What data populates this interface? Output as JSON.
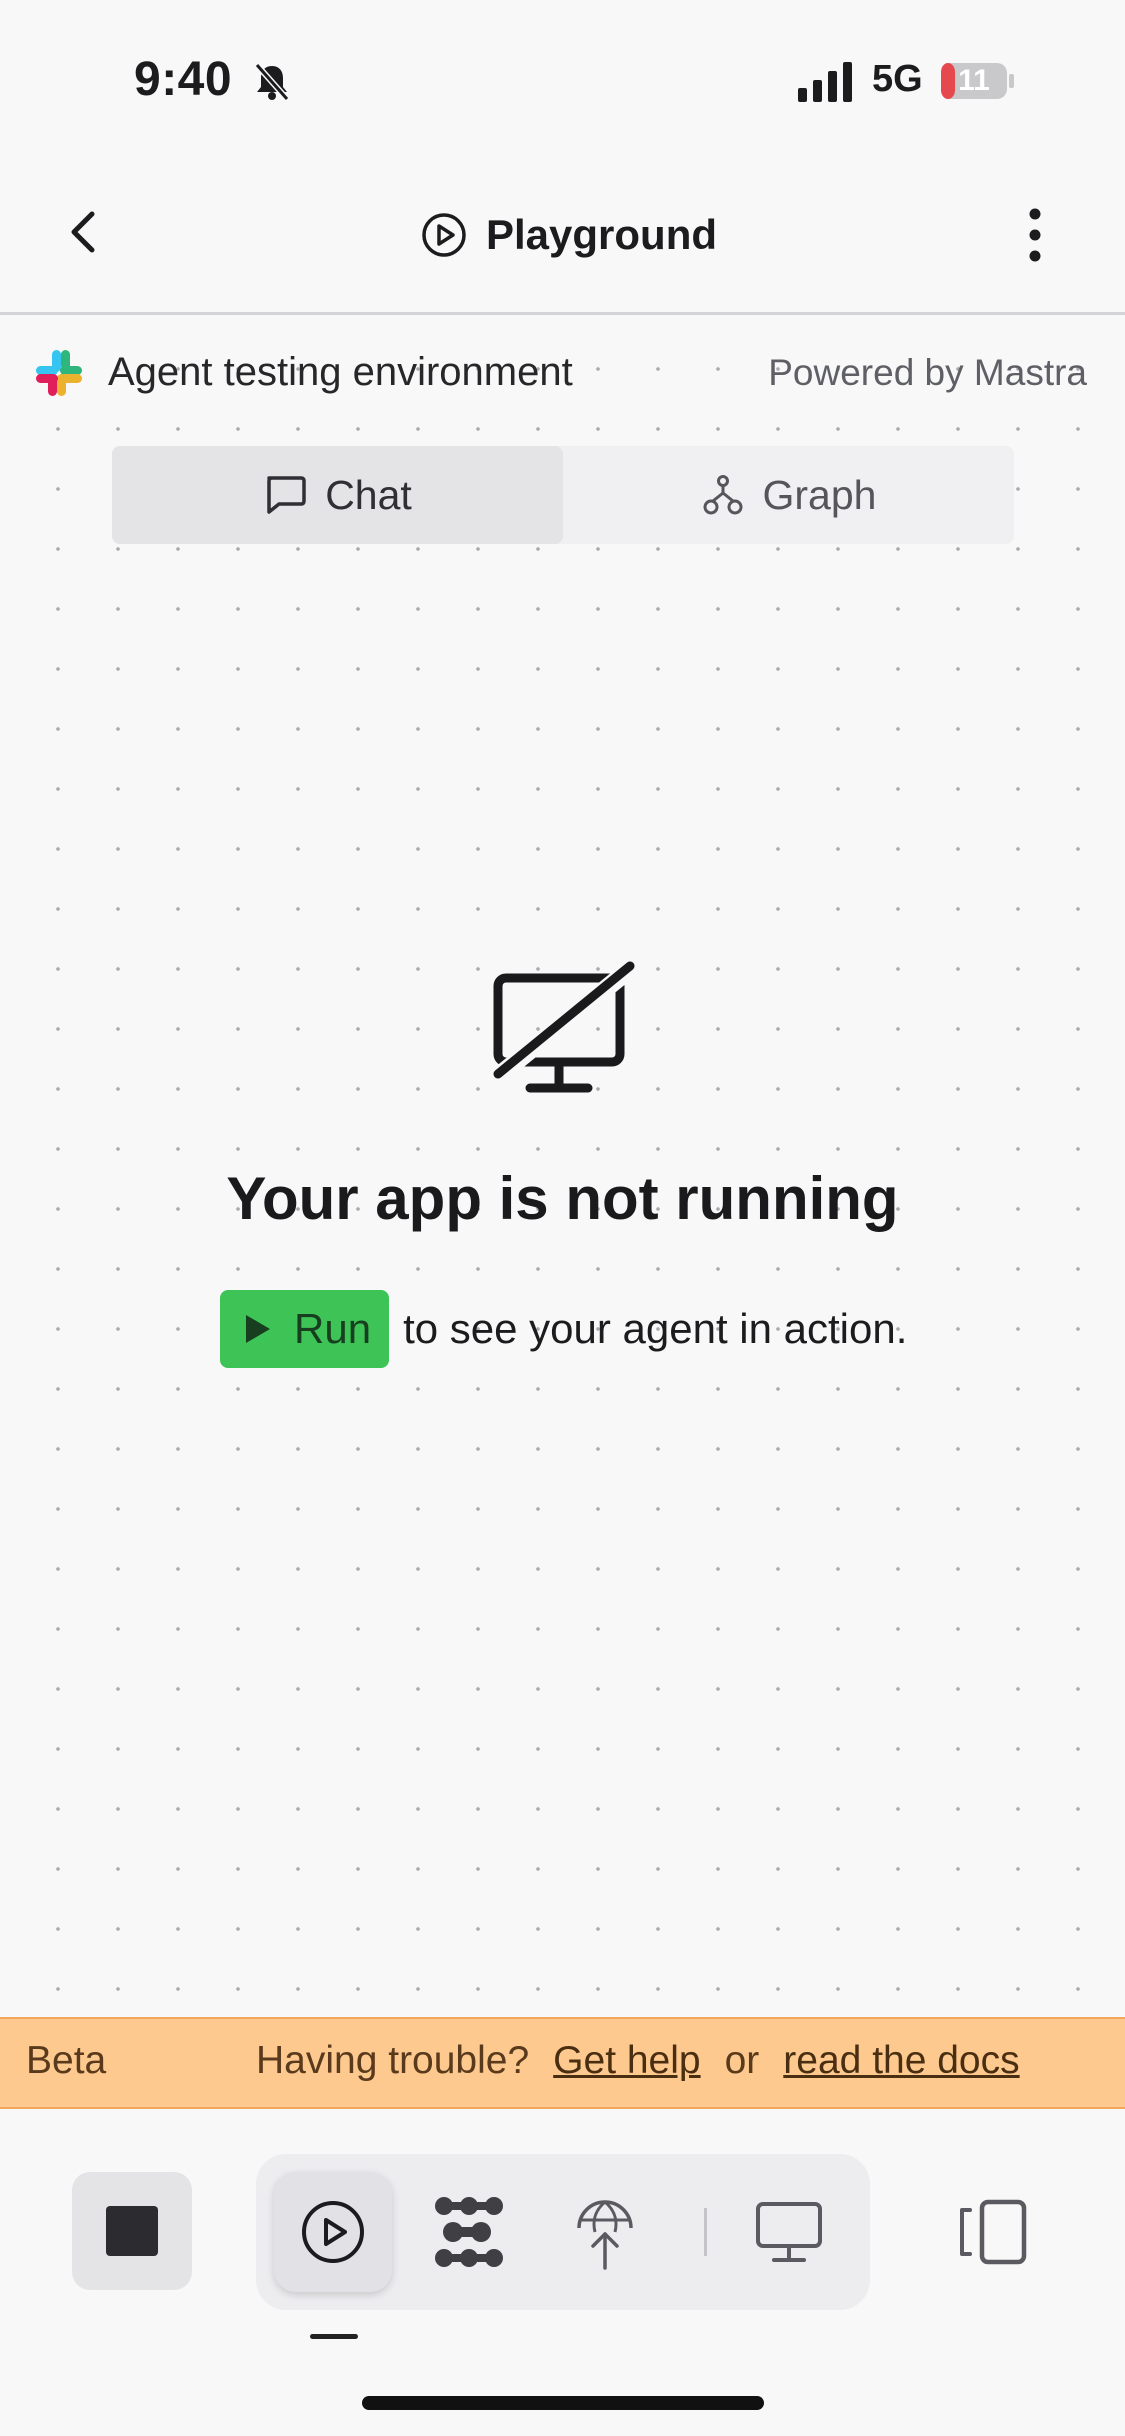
{
  "status_bar": {
    "time": "9:40",
    "network": "5G",
    "battery": "11"
  },
  "header": {
    "title": "Playground"
  },
  "env": {
    "title": "Agent testing environment",
    "powered_by": "Powered by Mastra"
  },
  "tabs": [
    {
      "label": "Chat",
      "icon": "chat-bubble-icon",
      "selected": true
    },
    {
      "label": "Graph",
      "icon": "graph-nodes-icon",
      "selected": false
    }
  ],
  "empty_state": {
    "title": "Your app is not running",
    "run_label": "Run",
    "run_suffix": "to see your agent in action."
  },
  "beta_banner": {
    "label": "Beta",
    "message": "Having trouble?",
    "help_link": "Get help",
    "or": "or",
    "docs_link": "read the docs"
  },
  "colors": {
    "run_green": "#3ec456",
    "banner": "#fdc98e",
    "battery_low": "#e5484d"
  },
  "toolbar": {
    "icons": [
      "stop-icon",
      "play-icon",
      "cluster-icon",
      "deploy-globe-icon",
      "monitor-icon",
      "panel-icon"
    ]
  }
}
